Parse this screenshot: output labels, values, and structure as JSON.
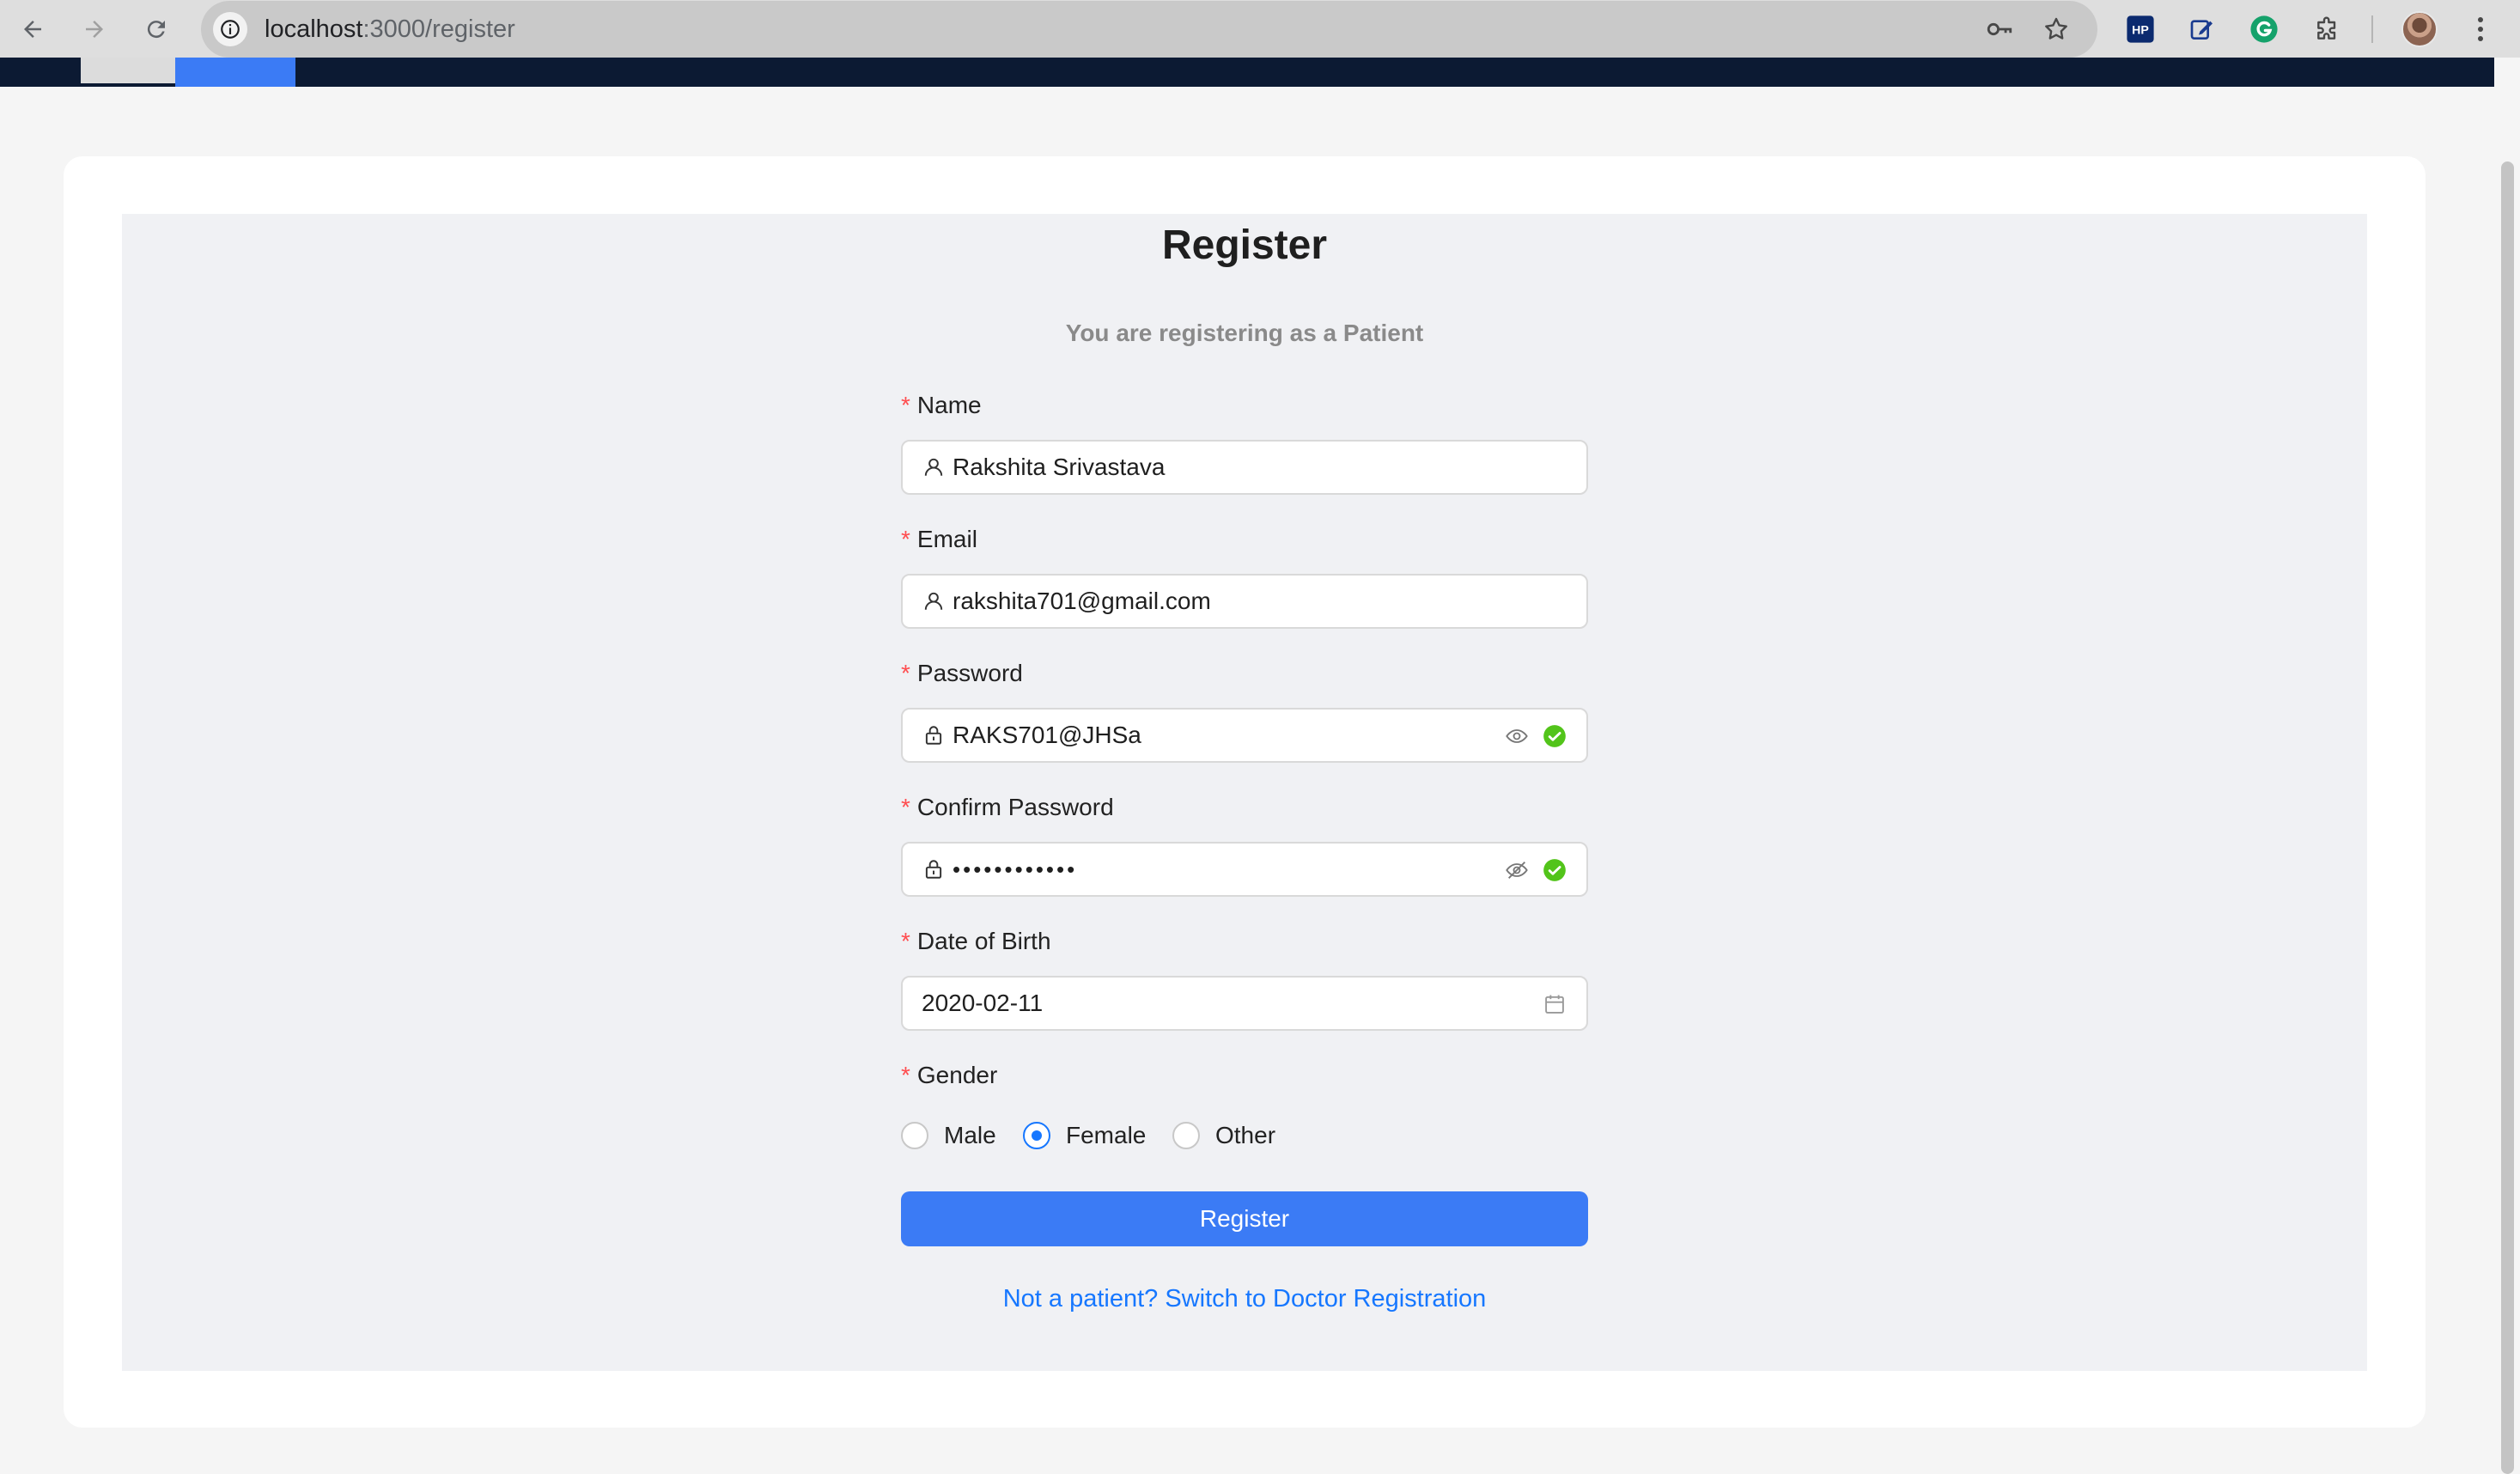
{
  "browser": {
    "url_host": "localhost",
    "url_path": ":3000/register"
  },
  "page": {
    "title": "Register",
    "subtitle": "You are registering as a Patient"
  },
  "form": {
    "name": {
      "label": "Name",
      "value": "Rakshita Srivastava",
      "icon": "user-icon"
    },
    "email": {
      "label": "Email",
      "value": "rakshita701@gmail.com",
      "icon": "user-icon"
    },
    "password": {
      "label": "Password",
      "value": "RAKS701@JHSa",
      "icon": "lock-icon",
      "visibility_icon": "eye-icon",
      "status_icon": "check-circle-icon"
    },
    "confirm_password": {
      "label": "Confirm Password",
      "value": "••••••••••••",
      "icon": "lock-icon",
      "visibility_icon": "eye-off-icon",
      "status_icon": "check-circle-icon"
    },
    "dob": {
      "label": "Date of Birth",
      "value": "2020-02-11",
      "icon": "calendar-icon"
    },
    "gender": {
      "label": "Gender",
      "options": [
        {
          "label": "Male",
          "selected": false
        },
        {
          "label": "Female",
          "selected": true
        },
        {
          "label": "Other",
          "selected": false
        }
      ]
    },
    "required_marker": "*",
    "submit_label": "Register",
    "switch_link": "Not a patient? Switch to Doctor Registration"
  },
  "colors": {
    "primary": "#3b7bf5",
    "link": "#1677ff",
    "success": "#52c41a",
    "required": "#ff4d4f",
    "header": "#0c1a33"
  }
}
